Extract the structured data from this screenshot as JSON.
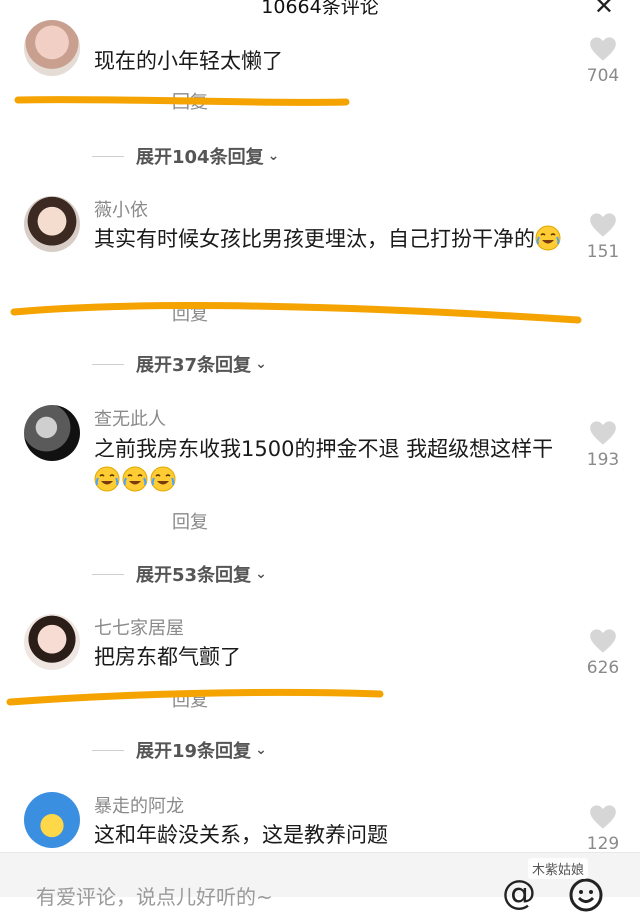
{
  "header": {
    "title": "10664条评论",
    "close_label": "✕"
  },
  "comments": [
    {
      "username": "",
      "text": "现在的小年轻太懒了",
      "reply_label": "回复",
      "likes": "704",
      "expand_label": "展开104条回复"
    },
    {
      "username": "薇小依",
      "text": "其实有时候女孩比男孩更埋汰，自己打扮干净的",
      "reply_label": "回复",
      "likes": "151",
      "expand_label": "展开37条回复"
    },
    {
      "username": "查无此人",
      "text": "之前我房东收我1500的押金不退  我超级想这样干",
      "reply_label": "回复",
      "likes": "193",
      "expand_label": "展开53条回复"
    },
    {
      "username": "七七家居屋",
      "text": "把房东都气颤了",
      "reply_label": "回复",
      "likes": "626",
      "expand_label": "展开19条回复"
    },
    {
      "username": "暴走的阿龙",
      "text": "这和年龄没关系，这是教养问题",
      "reply_label": "",
      "likes": "129",
      "expand_label": ""
    }
  ],
  "input": {
    "placeholder": "有爱评论，说点儿好听的~"
  },
  "icons": {
    "close": "close-icon",
    "heart": "heart-icon",
    "at": "at-icon",
    "emoji": "smile-icon",
    "laugh_emoji": "laughing-crying-emoji"
  },
  "colors": {
    "highlight": "#f4a300",
    "muted": "#8a8a8a"
  },
  "watermark": "木紫姑娘"
}
